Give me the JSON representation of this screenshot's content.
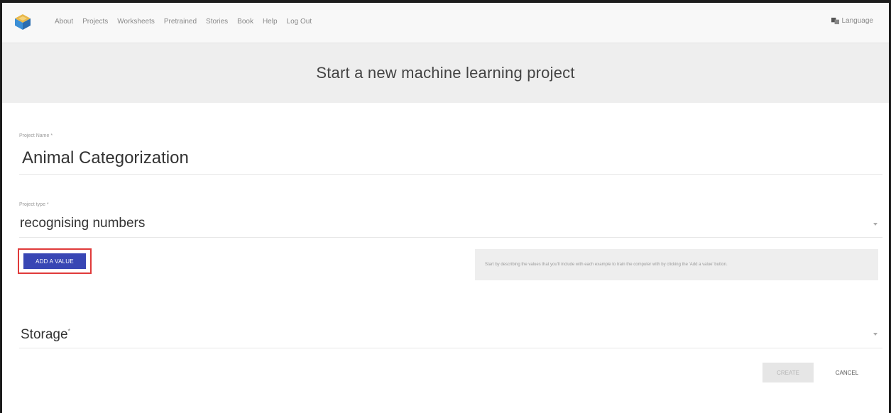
{
  "nav": {
    "links": [
      "About",
      "Projects",
      "Worksheets",
      "Pretrained",
      "Stories",
      "Book",
      "Help",
      "Log Out"
    ],
    "language": "Language"
  },
  "header": {
    "title": "Start a new machine learning project"
  },
  "form": {
    "project_name": {
      "label": "Project Name *",
      "value": "Animal Categorization"
    },
    "project_type": {
      "label": "Project type *",
      "value": "recognising numbers"
    },
    "add_value_label": "ADD A VALUE",
    "hint": "Start by describing the values that you'll include with each example to train the computer with by clicking the 'Add a value' button.",
    "storage": {
      "label": "Storage",
      "required_mark": "*"
    },
    "create_label": "CREATE",
    "cancel_label": "CANCEL"
  },
  "colors": {
    "accent": "#3846b4",
    "highlight_outline": "#e03a3a",
    "header_band": "#eeeeee"
  },
  "icons": {
    "logo": "ml4k-cube-logo",
    "language": "translate-icon",
    "dropdown": "chevron-down-icon"
  }
}
